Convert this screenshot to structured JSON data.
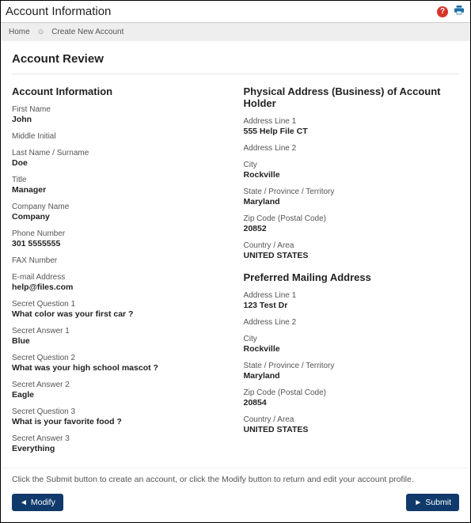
{
  "titlebar": {
    "title": "Account Information"
  },
  "breadcrumb": {
    "home": "Home",
    "current": "Create New Account"
  },
  "page_title": "Account Review",
  "account_info": {
    "heading": "Account Information",
    "fields": [
      {
        "label": "First Name",
        "value": "John"
      },
      {
        "label": "Middle Initial",
        "value": ""
      },
      {
        "label": "Last Name / Surname",
        "value": "Doe"
      },
      {
        "label": "Title",
        "value": "Manager"
      },
      {
        "label": "Company Name",
        "value": "Company"
      },
      {
        "label": "Phone Number",
        "value": "301 5555555"
      },
      {
        "label": "FAX Number",
        "value": ""
      },
      {
        "label": "E-mail Address",
        "value": "help@files.com"
      },
      {
        "label": "Secret Question 1",
        "value": "What color was your first car ?"
      },
      {
        "label": "Secret Answer 1",
        "value": "Blue"
      },
      {
        "label": "Secret Question 2",
        "value": "What was your high school mascot ?"
      },
      {
        "label": "Secret Answer 2",
        "value": "Eagle"
      },
      {
        "label": "Secret Question 3",
        "value": "What is your favorite food ?"
      },
      {
        "label": "Secret Answer 3",
        "value": "Everything"
      }
    ]
  },
  "physical_address": {
    "heading": "Physical Address (Business) of Account Holder",
    "fields": [
      {
        "label": "Address Line 1",
        "value": "555 Help File CT"
      },
      {
        "label": "Address Line 2",
        "value": ""
      },
      {
        "label": "City",
        "value": "Rockville"
      },
      {
        "label": "State / Province / Territory",
        "value": "Maryland"
      },
      {
        "label": "Zip Code (Postal Code)",
        "value": "20852"
      },
      {
        "label": "Country / Area",
        "value": "UNITED STATES"
      }
    ]
  },
  "mailing_address": {
    "heading": "Preferred Mailing Address",
    "fields": [
      {
        "label": "Address Line 1",
        "value": "123 Test Dr"
      },
      {
        "label": "Address Line 2",
        "value": ""
      },
      {
        "label": "City",
        "value": "Rockville"
      },
      {
        "label": "State / Province / Territory",
        "value": "Maryland"
      },
      {
        "label": "Zip Code (Postal Code)",
        "value": "20854"
      },
      {
        "label": "Country / Area",
        "value": "UNITED STATES"
      }
    ]
  },
  "instruction": "Click the Submit button to create an account, or click the Modify button to return and edit your account profile.",
  "buttons": {
    "modify": "Modify",
    "submit": "Submit"
  }
}
